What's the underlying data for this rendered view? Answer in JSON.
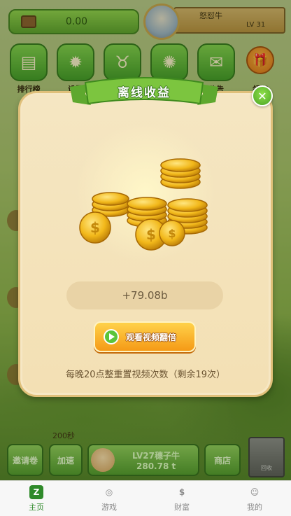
{
  "topbar": {
    "cash": "0.00",
    "player_name": "怒怼牛",
    "player_level": "LV 31"
  },
  "icon_row": [
    {
      "label": "排行榜",
      "icon": "leaderboard-icon"
    },
    {
      "label": "设置",
      "icon": "gear-icon"
    },
    {
      "label": "",
      "icon": "cow-icon"
    },
    {
      "label": "",
      "icon": "wheel-icon"
    },
    {
      "label": "公告",
      "icon": "mail-icon"
    }
  ],
  "gift": {
    "label": "领取",
    "icon": "gift-icon"
  },
  "modal": {
    "title": "离线收益",
    "amount": "+79.08b",
    "video_button": "观看视频翻倍",
    "reset_note": "每晚20点整重置视频次数（剩余19次）",
    "close_icon": "close-icon"
  },
  "actions": {
    "timer": "200秒",
    "invite": "邀请卷",
    "speed": "加速",
    "buy_title": "LV27穗子牛",
    "buy_price": "280.78 t",
    "shop": "商店",
    "trash": "回收"
  },
  "tabs": [
    {
      "label": "主页",
      "icon": "home-icon",
      "glyph": "Z",
      "active": true
    },
    {
      "label": "游戏",
      "icon": "gamepad-icon",
      "glyph": "◎",
      "active": false
    },
    {
      "label": "财富",
      "icon": "money-bag-icon",
      "glyph": "$",
      "active": false
    },
    {
      "label": "我的",
      "icon": "profile-icon",
      "glyph": "☺",
      "active": false
    }
  ],
  "colors": {
    "accent_green": "#2f8a2a",
    "modal_bg": "#f5e6c2",
    "button_orange": "#f59a16"
  }
}
